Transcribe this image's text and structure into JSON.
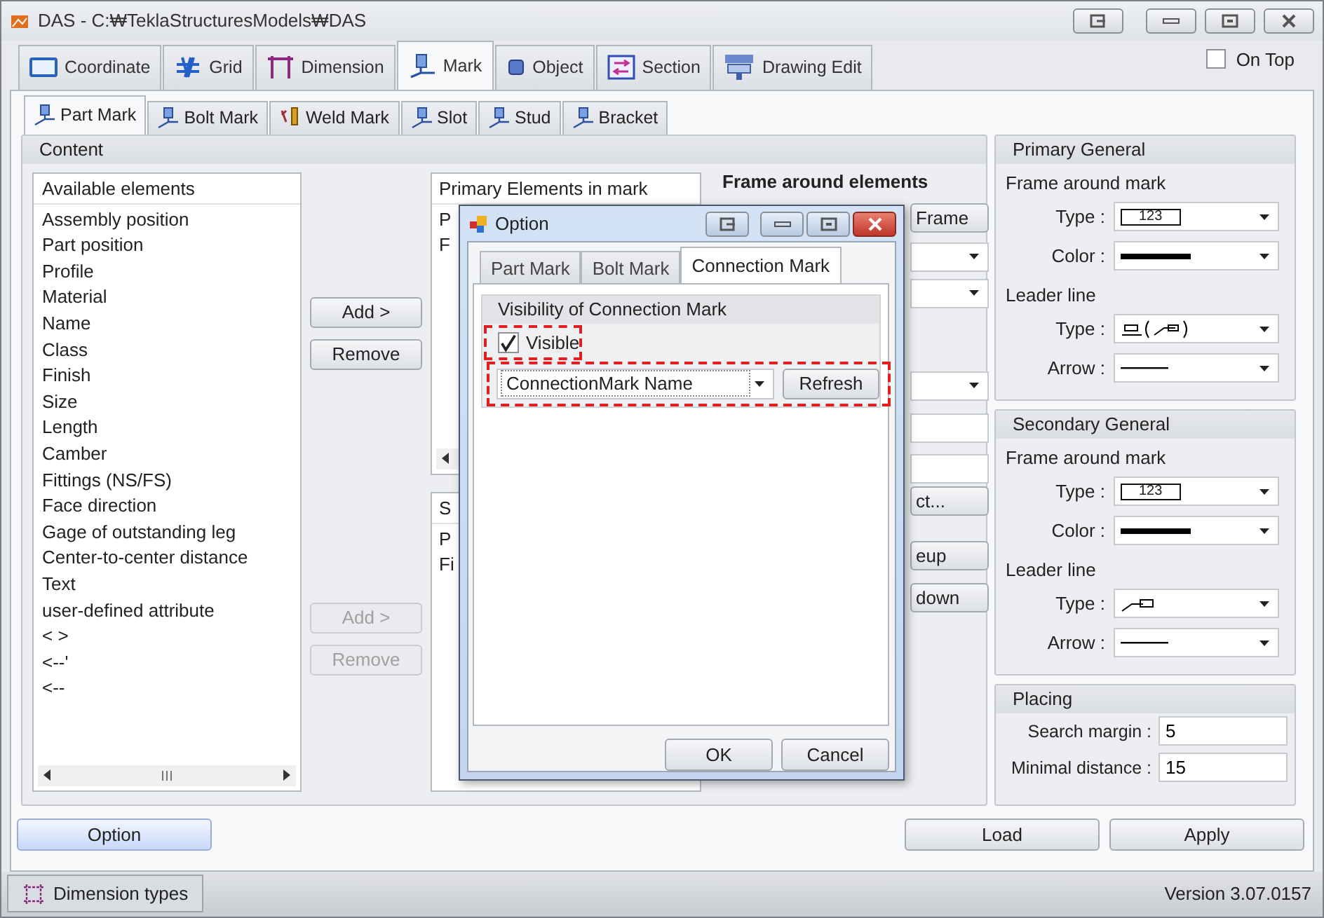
{
  "window": {
    "title": "DAS - C:₩TeklaStructuresModels₩DAS"
  },
  "main_tabs": [
    {
      "label": "Coordinate",
      "selected": false
    },
    {
      "label": "Grid",
      "selected": false
    },
    {
      "label": "Dimension",
      "selected": false
    },
    {
      "label": "Mark",
      "selected": true
    },
    {
      "label": "Object",
      "selected": false
    },
    {
      "label": "Section",
      "selected": false
    },
    {
      "label": "Drawing Edit",
      "selected": false
    }
  ],
  "on_top": {
    "label": "On Top",
    "checked": false
  },
  "sub_tabs": [
    {
      "label": "Part Mark",
      "selected": true
    },
    {
      "label": "Bolt Mark",
      "selected": false
    },
    {
      "label": "Weld Mark",
      "selected": false
    },
    {
      "label": "Slot",
      "selected": false
    },
    {
      "label": "Stud",
      "selected": false
    },
    {
      "label": "Bracket",
      "selected": false
    }
  ],
  "content": {
    "title": "Content",
    "available": {
      "header": "Available elements",
      "items": [
        "Assembly position",
        "Part position",
        "Profile",
        "Material",
        "Name",
        "Class",
        "Finish",
        "Size",
        "Length",
        "Camber",
        "Fittings (NS/FS)",
        "Face direction",
        "Gage of outstanding leg",
        "Center-to-center distance",
        "Text",
        "user-defined attribute",
        "< >",
        "<--'",
        "<--"
      ]
    },
    "primary_buttons": [
      {
        "label": "Add >",
        "disabled": false
      },
      {
        "label": "Remove",
        "disabled": false
      }
    ],
    "secondary_buttons": [
      {
        "label": "Add >",
        "disabled": true
      },
      {
        "label": "Remove",
        "disabled": true
      }
    ],
    "primary_list": {
      "header": "Primary Elements in mark",
      "items": [
        "P",
        "F"
      ]
    },
    "secondary_list": {
      "header": "S",
      "items": [
        "P",
        "Fi"
      ]
    },
    "frame_label": "Frame around elements",
    "frame_controls": [
      {
        "kind": "button",
        "label": "Frame"
      },
      {
        "kind": "dropdown"
      },
      {
        "kind": "dropdown"
      },
      {
        "kind": "dropdown"
      },
      {
        "kind": "field"
      },
      {
        "kind": "field"
      },
      {
        "kind": "button",
        "label": "ct..."
      },
      {
        "kind": "button",
        "label": "eup"
      },
      {
        "kind": "button",
        "label": "down"
      }
    ]
  },
  "groups": [
    {
      "title": "Primary General",
      "sections": [
        {
          "label": "Frame around mark",
          "rows": [
            {
              "label": "Type :",
              "kind": "frame",
              "value": "123"
            },
            {
              "label": "Color :",
              "kind": "color"
            }
          ]
        },
        {
          "label": "Leader line",
          "rows": [
            {
              "label": "Type :",
              "kind": "leader-bracket"
            },
            {
              "label": "Arrow :",
              "kind": "line"
            }
          ]
        }
      ]
    },
    {
      "title": "Secondary General",
      "sections": [
        {
          "label": "Frame around mark",
          "rows": [
            {
              "label": "Type :",
              "kind": "frame",
              "value": "123"
            },
            {
              "label": "Color :",
              "kind": "color"
            }
          ]
        },
        {
          "label": "Leader line",
          "rows": [
            {
              "label": "Type :",
              "kind": "leader"
            },
            {
              "label": "Arrow :",
              "kind": "line"
            }
          ]
        }
      ]
    }
  ],
  "placing": {
    "title": "Placing",
    "rows": [
      {
        "label": "Search margin :",
        "value": "5"
      },
      {
        "label": "Minimal distance :",
        "value": "15"
      }
    ]
  },
  "bottom_buttons": {
    "option": "Option",
    "load": "Load",
    "apply": "Apply"
  },
  "status_bar": {
    "button": "Dimension types",
    "version": "Version 3.07.0157"
  },
  "dialog": {
    "title": "Option",
    "tabs": [
      {
        "label": "Part Mark",
        "selected": false
      },
      {
        "label": "Bolt Mark",
        "selected": false
      },
      {
        "label": "Connection Mark",
        "selected": true
      }
    ],
    "group_title": "Visibility of Connection Mark",
    "visible": {
      "label": "Visible",
      "checked": true
    },
    "name_dropdown": {
      "value": "ConnectionMark Name"
    },
    "refresh": "Refresh",
    "ok": "OK",
    "cancel": "Cancel"
  }
}
